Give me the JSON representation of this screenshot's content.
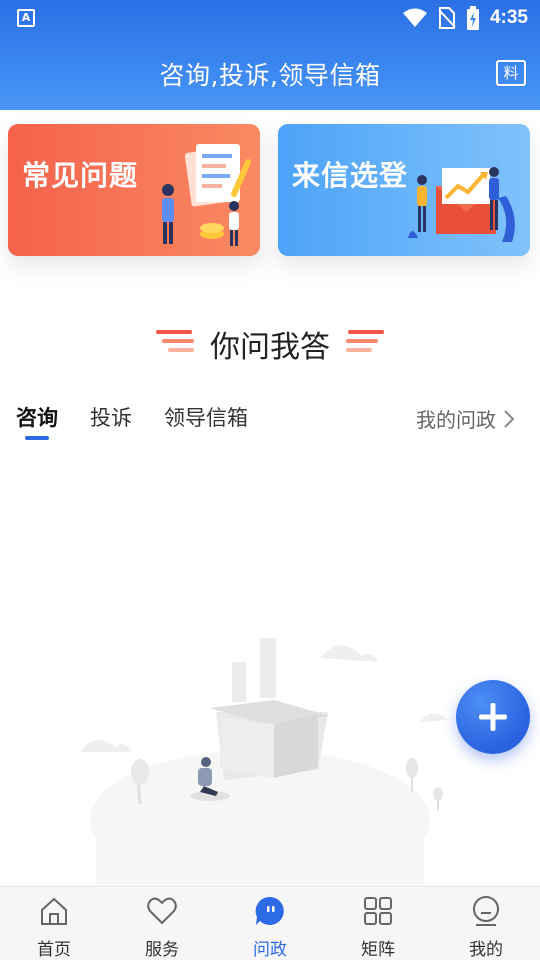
{
  "status_bar": {
    "app_indicator": "A",
    "time": "4:35",
    "icons": [
      "wifi-icon",
      "no-sim-icon",
      "battery-charging-icon"
    ]
  },
  "header": {
    "title": "咨询,投诉,领导信箱",
    "action_icon_text": "料",
    "action_icon": "info-bubble-icon"
  },
  "cards": [
    {
      "label": "常见问题",
      "icon": "documents-people-illustration",
      "color": "#f5624c"
    },
    {
      "label": "来信选登",
      "icon": "envelope-chart-illustration",
      "color": "#4da3f8"
    }
  ],
  "section": {
    "heading": "你问我答",
    "accent_color": "#f0564a"
  },
  "tabs": {
    "items": [
      "咨询",
      "投诉",
      "领导信箱"
    ],
    "active_index": 0,
    "my_link": "我的问政"
  },
  "fab": {
    "icon": "plus-icon",
    "color": "#2d6be6"
  },
  "bottom_nav": {
    "items": [
      {
        "label": "首页",
        "icon": "home-icon"
      },
      {
        "label": "服务",
        "icon": "heart-icon"
      },
      {
        "label": "问政",
        "icon": "chat-bubble-icon"
      },
      {
        "label": "矩阵",
        "icon": "grid-icon"
      },
      {
        "label": "我的",
        "icon": "profile-icon"
      }
    ],
    "active_index": 2,
    "active_color": "#2d6be6"
  }
}
